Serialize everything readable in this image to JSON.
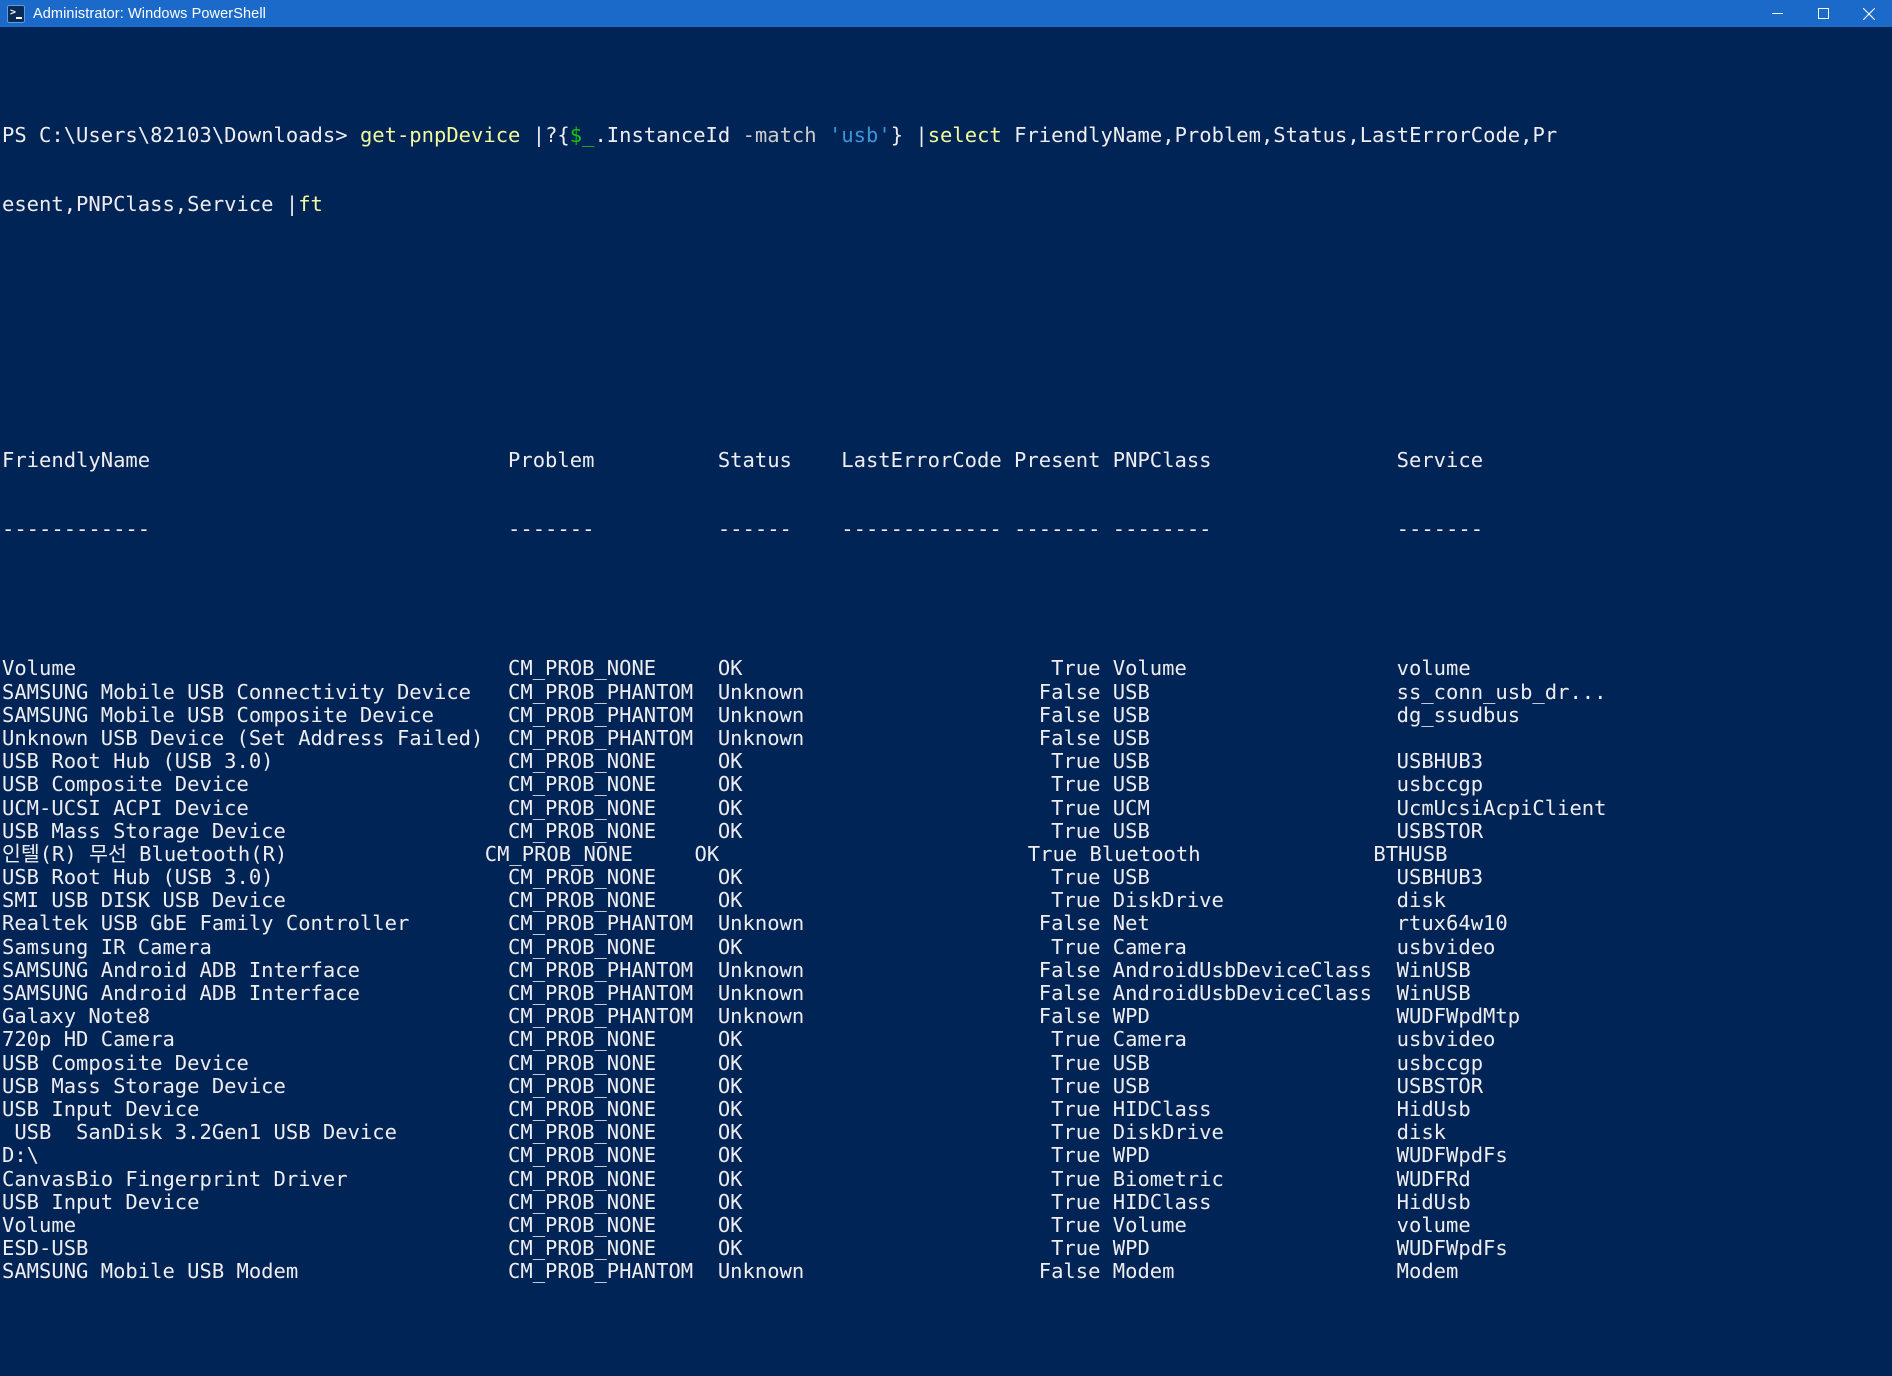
{
  "window": {
    "title": "Administrator: Windows PowerShell",
    "icon": "powershell-icon",
    "controls": {
      "minimize": "minimize-icon",
      "maximize": "maximize-icon",
      "close": "close-icon"
    }
  },
  "colors": {
    "titlebar_bg": "#1b6ac9",
    "console_bg": "#012456",
    "text": "#eeedf0",
    "cmdlet": "#f3f99d",
    "variable": "#16c60c",
    "string": "#3a96dd",
    "parameter": "#cccccc"
  },
  "prompt": {
    "ps_label": "PS ",
    "path": "C:\\Users\\82103\\Downloads",
    "caret": "> "
  },
  "command": {
    "full": "get-pnpDevice |?{$_.InstanceId -match 'usb'} |select FriendlyName,Problem,Status,LastErrorCode,Present,PNPClass,Service |ft",
    "line1_tokens": [
      {
        "text": "get-pnpDevice ",
        "color": "cmdlet"
      },
      {
        "text": "|?{",
        "color": "text"
      },
      {
        "text": "$_",
        "color": "variable"
      },
      {
        "text": ".InstanceId ",
        "color": "text"
      },
      {
        "text": "-match ",
        "color": "parameter"
      },
      {
        "text": "'usb'",
        "color": "string"
      },
      {
        "text": "} ",
        "color": "text"
      },
      {
        "text": "|",
        "color": "text"
      },
      {
        "text": "select ",
        "color": "cmdlet"
      },
      {
        "text": "FriendlyName,Problem,Status,LastErrorCode,Pr",
        "color": "text"
      }
    ],
    "line2_tokens": [
      {
        "text": "esent,PNPClass,Service ",
        "color": "text"
      },
      {
        "text": "|",
        "color": "text"
      },
      {
        "text": "ft",
        "color": "cmdlet"
      }
    ]
  },
  "table": {
    "columns": [
      {
        "key": "FriendlyName",
        "header": "FriendlyName",
        "rule": "------------"
      },
      {
        "key": "Problem",
        "header": "Problem",
        "rule": "-------"
      },
      {
        "key": "Status",
        "header": "Status",
        "rule": "------"
      },
      {
        "key": "LastErrorCode",
        "header": "LastErrorCode",
        "rule": "-------------"
      },
      {
        "key": "Present",
        "header": "Present",
        "rule": "-------"
      },
      {
        "key": "PNPClass",
        "header": "PNPClass",
        "rule": "--------"
      },
      {
        "key": "Service",
        "header": "Service",
        "rule": "-------"
      }
    ],
    "rows": [
      {
        "FriendlyName": "Volume",
        "Problem": "CM_PROB_NONE",
        "Status": "OK",
        "LastErrorCode": "",
        "Present": "True",
        "PNPClass": "Volume",
        "Service": "volume"
      },
      {
        "FriendlyName": "SAMSUNG Mobile USB Connectivity Device",
        "Problem": "CM_PROB_PHANTOM",
        "Status": "Unknown",
        "LastErrorCode": "",
        "Present": "False",
        "PNPClass": "USB",
        "Service": "ss_conn_usb_dr..."
      },
      {
        "FriendlyName": "SAMSUNG Mobile USB Composite Device",
        "Problem": "CM_PROB_PHANTOM",
        "Status": "Unknown",
        "LastErrorCode": "",
        "Present": "False",
        "PNPClass": "USB",
        "Service": "dg_ssudbus"
      },
      {
        "FriendlyName": "Unknown USB Device (Set Address Failed)",
        "Problem": "CM_PROB_PHANTOM",
        "Status": "Unknown",
        "LastErrorCode": "",
        "Present": "False",
        "PNPClass": "USB",
        "Service": ""
      },
      {
        "FriendlyName": "USB Root Hub (USB 3.0)",
        "Problem": "CM_PROB_NONE",
        "Status": "OK",
        "LastErrorCode": "",
        "Present": "True",
        "PNPClass": "USB",
        "Service": "USBHUB3"
      },
      {
        "FriendlyName": "USB Composite Device",
        "Problem": "CM_PROB_NONE",
        "Status": "OK",
        "LastErrorCode": "",
        "Present": "True",
        "PNPClass": "USB",
        "Service": "usbccgp"
      },
      {
        "FriendlyName": "UCM-UCSI ACPI Device",
        "Problem": "CM_PROB_NONE",
        "Status": "OK",
        "LastErrorCode": "",
        "Present": "True",
        "PNPClass": "UCM",
        "Service": "UcmUcsiAcpiClient"
      },
      {
        "FriendlyName": "USB Mass Storage Device",
        "Problem": "CM_PROB_NONE",
        "Status": "OK",
        "LastErrorCode": "",
        "Present": "True",
        "PNPClass": "USB",
        "Service": "USBSTOR"
      },
      {
        "FriendlyName": "인텔(R) 무선 Bluetooth(R)",
        "Problem": "CM_PROB_NONE",
        "Status": "OK",
        "LastErrorCode": "",
        "Present": "True",
        "PNPClass": "Bluetooth",
        "Service": "BTHUSB"
      },
      {
        "FriendlyName": "USB Root Hub (USB 3.0)",
        "Problem": "CM_PROB_NONE",
        "Status": "OK",
        "LastErrorCode": "",
        "Present": "True",
        "PNPClass": "USB",
        "Service": "USBHUB3"
      },
      {
        "FriendlyName": "SMI USB DISK USB Device",
        "Problem": "CM_PROB_NONE",
        "Status": "OK",
        "LastErrorCode": "",
        "Present": "True",
        "PNPClass": "DiskDrive",
        "Service": "disk"
      },
      {
        "FriendlyName": "Realtek USB GbE Family Controller",
        "Problem": "CM_PROB_PHANTOM",
        "Status": "Unknown",
        "LastErrorCode": "",
        "Present": "False",
        "PNPClass": "Net",
        "Service": "rtux64w10"
      },
      {
        "FriendlyName": "Samsung IR Camera",
        "Problem": "CM_PROB_NONE",
        "Status": "OK",
        "LastErrorCode": "",
        "Present": "True",
        "PNPClass": "Camera",
        "Service": "usbvideo"
      },
      {
        "FriendlyName": "SAMSUNG Android ADB Interface",
        "Problem": "CM_PROB_PHANTOM",
        "Status": "Unknown",
        "LastErrorCode": "",
        "Present": "False",
        "PNPClass": "AndroidUsbDeviceClass",
        "Service": "WinUSB"
      },
      {
        "FriendlyName": "SAMSUNG Android ADB Interface",
        "Problem": "CM_PROB_PHANTOM",
        "Status": "Unknown",
        "LastErrorCode": "",
        "Present": "False",
        "PNPClass": "AndroidUsbDeviceClass",
        "Service": "WinUSB"
      },
      {
        "FriendlyName": "Galaxy Note8",
        "Problem": "CM_PROB_PHANTOM",
        "Status": "Unknown",
        "LastErrorCode": "",
        "Present": "False",
        "PNPClass": "WPD",
        "Service": "WUDFWpdMtp"
      },
      {
        "FriendlyName": "720p HD Camera",
        "Problem": "CM_PROB_NONE",
        "Status": "OK",
        "LastErrorCode": "",
        "Present": "True",
        "PNPClass": "Camera",
        "Service": "usbvideo"
      },
      {
        "FriendlyName": "USB Composite Device",
        "Problem": "CM_PROB_NONE",
        "Status": "OK",
        "LastErrorCode": "",
        "Present": "True",
        "PNPClass": "USB",
        "Service": "usbccgp"
      },
      {
        "FriendlyName": "USB Mass Storage Device",
        "Problem": "CM_PROB_NONE",
        "Status": "OK",
        "LastErrorCode": "",
        "Present": "True",
        "PNPClass": "USB",
        "Service": "USBSTOR"
      },
      {
        "FriendlyName": "USB Input Device",
        "Problem": "CM_PROB_NONE",
        "Status": "OK",
        "LastErrorCode": "",
        "Present": "True",
        "PNPClass": "HIDClass",
        "Service": "HidUsb"
      },
      {
        "FriendlyName": " USB  SanDisk 3.2Gen1 USB Device",
        "Problem": "CM_PROB_NONE",
        "Status": "OK",
        "LastErrorCode": "",
        "Present": "True",
        "PNPClass": "DiskDrive",
        "Service": "disk"
      },
      {
        "FriendlyName": "D:\\",
        "Problem": "CM_PROB_NONE",
        "Status": "OK",
        "LastErrorCode": "",
        "Present": "True",
        "PNPClass": "WPD",
        "Service": "WUDFWpdFs"
      },
      {
        "FriendlyName": "CanvasBio Fingerprint Driver",
        "Problem": "CM_PROB_NONE",
        "Status": "OK",
        "LastErrorCode": "",
        "Present": "True",
        "PNPClass": "Biometric",
        "Service": "WUDFRd"
      },
      {
        "FriendlyName": "USB Input Device",
        "Problem": "CM_PROB_NONE",
        "Status": "OK",
        "LastErrorCode": "",
        "Present": "True",
        "PNPClass": "HIDClass",
        "Service": "HidUsb"
      },
      {
        "FriendlyName": "Volume",
        "Problem": "CM_PROB_NONE",
        "Status": "OK",
        "LastErrorCode": "",
        "Present": "True",
        "PNPClass": "Volume",
        "Service": "volume"
      },
      {
        "FriendlyName": "ESD-USB",
        "Problem": "CM_PROB_NONE",
        "Status": "OK",
        "LastErrorCode": "",
        "Present": "True",
        "PNPClass": "WPD",
        "Service": "WUDFWpdFs"
      },
      {
        "FriendlyName": "SAMSUNG Mobile USB Modem",
        "Problem": "CM_PROB_PHANTOM",
        "Status": "Unknown",
        "LastErrorCode": "",
        "Present": "False",
        "PNPClass": "Modem",
        "Service": "Modem"
      }
    ]
  },
  "layout": {
    "col_char_widths": {
      "FriendlyName": 40,
      "Problem": 16,
      "Status": 8,
      "LastErrorCode": 14,
      "Present": 7,
      "PNPClass": 22,
      "Service": 17
    }
  }
}
